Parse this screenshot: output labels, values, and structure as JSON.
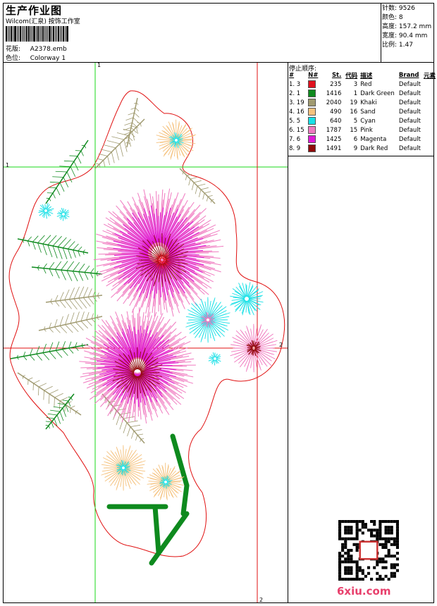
{
  "header": {
    "title": "生产作业图",
    "company": "Wilcom(汇泉) 按饰工作室",
    "design_label": "花版:",
    "design_value": "A2378.emb",
    "colorway_label": "色位:",
    "colorway_value": "Colorway 1"
  },
  "stats": [
    {
      "label": "针数:",
      "value": "9526"
    },
    {
      "label": "颜色:",
      "value": "8"
    },
    {
      "label": "高度:",
      "value": "157.2 mm"
    },
    {
      "label": "宽度:",
      "value": "90.4 mm"
    },
    {
      "label": "比例:",
      "value": "1.47"
    }
  ],
  "stop_sequence": {
    "title": "停止顺序:",
    "headers": [
      "#",
      "N#",
      "St.",
      "代码",
      "描述",
      "Brand",
      "元素"
    ],
    "rows": [
      {
        "seq": "1. 3",
        "color": "#e0101e",
        "st": "235",
        "code": "3",
        "desc": "Red",
        "brand": "Default"
      },
      {
        "seq": "2. 1",
        "color": "#0e8a1e",
        "st": "1416",
        "code": "1",
        "desc": "Dark Green",
        "brand": "Default"
      },
      {
        "seq": "3. 19",
        "color": "#a09a70",
        "st": "2040",
        "code": "19",
        "desc": "Khaki",
        "brand": "Default"
      },
      {
        "seq": "4. 16",
        "color": "#f5c27e",
        "st": "490",
        "code": "16",
        "desc": "Sand",
        "brand": "Default"
      },
      {
        "seq": "5. 5",
        "color": "#18e0e6",
        "st": "640",
        "code": "5",
        "desc": "Cyan",
        "brand": "Default"
      },
      {
        "seq": "6. 15",
        "color": "#f07ac0",
        "st": "1787",
        "code": "15",
        "desc": "Pink",
        "brand": "Default"
      },
      {
        "seq": "7. 6",
        "color": "#e01ad6",
        "st": "1425",
        "code": "6",
        "desc": "Magenta",
        "brand": "Default"
      },
      {
        "seq": "8. 9",
        "color": "#900a0a",
        "st": "1491",
        "code": "9",
        "desc": "Dark Red",
        "brand": "Default"
      }
    ]
  },
  "guides": {
    "h1": "1",
    "v1": "1",
    "h2": "2",
    "v2": "2"
  },
  "watermark": "6xiu.com"
}
